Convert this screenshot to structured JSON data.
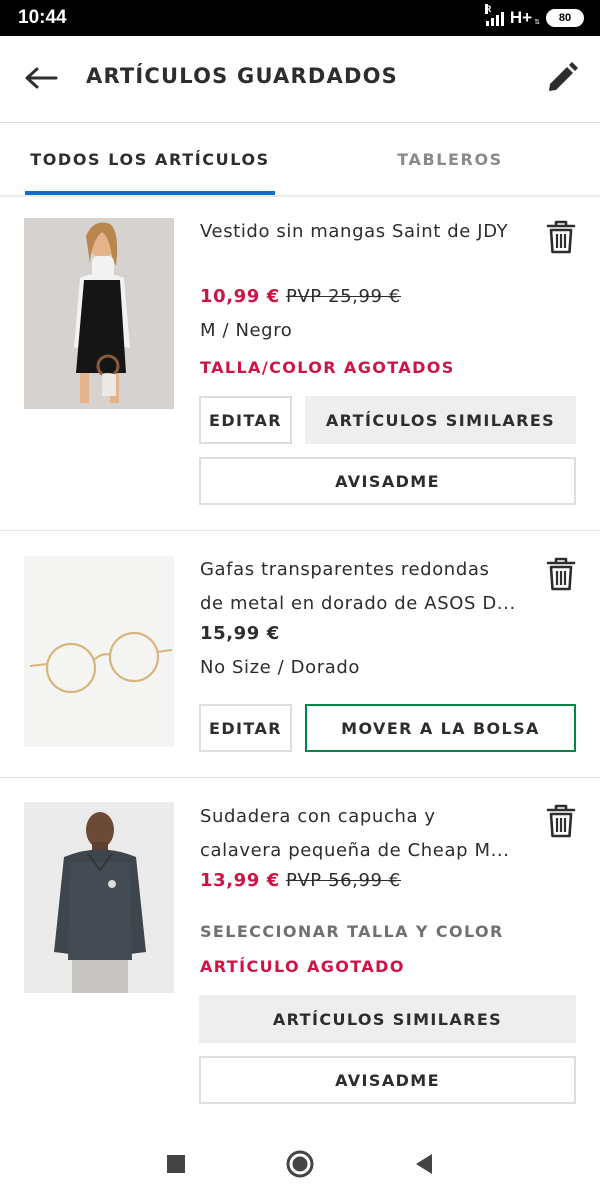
{
  "status_bar": {
    "time": "10:44",
    "signal_roaming": "R",
    "network_type": "H+",
    "battery_level": "80"
  },
  "header": {
    "title": "ARTÍCULOS GUARDADOS",
    "back_icon": "arrow-left-icon",
    "edit_icon": "pencil-icon"
  },
  "tabs": [
    {
      "label": "TODOS LOS ARTÍCULOS",
      "active": true
    },
    {
      "label": "TABLEROS",
      "active": false
    }
  ],
  "items": [
    {
      "name_lines": [
        "Vestido sin mangas Saint de JDY"
      ],
      "price": "10,99 €",
      "price_rrp": "PVP 25,99 €",
      "variant": "M / Negro",
      "warning": "TALLA/COLOR AGOTADOS",
      "buttons": {
        "edit": "EDITAR",
        "similar": "ARTÍCULOS SIMILARES",
        "notify": "AVISADME"
      }
    },
    {
      "name_lines": [
        "Gafas transparentes redondas",
        "de metal en dorado de ASOS D..."
      ],
      "price": "15,99 €",
      "variant": "No Size / Dorado",
      "buttons": {
        "edit": "EDITAR",
        "move_to_bag": "MOVER A LA BOLSA"
      }
    },
    {
      "name_lines": [
        "Sudadera con capucha y",
        "calavera pequeña de Cheap M..."
      ],
      "price": "13,99 €",
      "price_rrp": "PVP 56,99 €",
      "select_size": "SELECCIONAR TALLA Y COLOR",
      "warning": "ARTÍCULO AGOTADO",
      "buttons": {
        "similar": "ARTÍCULOS SIMILARES",
        "notify": "AVISADME"
      }
    }
  ],
  "colors": {
    "sale_price": "#d01345",
    "tab_indicator": "#0770cf",
    "move_to_bag_border": "#018849",
    "grey_button": "#eeeeee"
  },
  "nav_bar": {
    "icons": [
      "square-recents-icon",
      "circle-home-icon",
      "triangle-back-icon"
    ]
  }
}
